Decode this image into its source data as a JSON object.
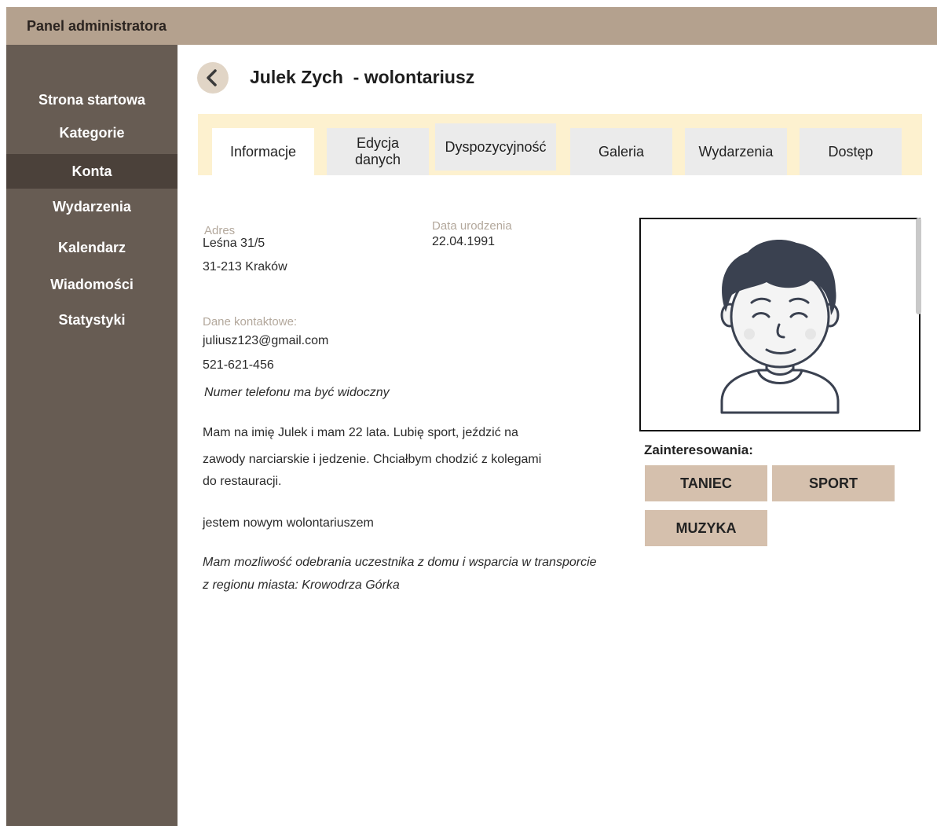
{
  "app": {
    "title": "Panel administratora"
  },
  "sidebar": {
    "items": [
      {
        "label": "Strona startowa"
      },
      {
        "label": "Kategorie"
      },
      {
        "label": "Konta",
        "active": true
      },
      {
        "label": "Wydarzenia"
      },
      {
        "label": "Kalendarz"
      },
      {
        "label": "Wiadomości"
      },
      {
        "label": "Statystyki"
      }
    ]
  },
  "page": {
    "title": "Julek Zych  - wolontariusz"
  },
  "tabs": [
    {
      "label": "Informacje",
      "active": true
    },
    {
      "label": "Edycja\ndanych"
    },
    {
      "label": "Dyspozycyjność"
    },
    {
      "label": "Galeria"
    },
    {
      "label": "Wydarzenia"
    },
    {
      "label": "Dostęp"
    }
  ],
  "profile": {
    "address_label": "Adres",
    "address_line1": "Leśna 31/5",
    "address_line2": "31-213 Kraków",
    "birth_label": "Data urodzenia",
    "birth_date": "22.04.1991",
    "contact_label": "Dane kontaktowe:",
    "email": "juliusz123@gmail.com",
    "phone": "521-621-456",
    "phone_note": "Numer telefonu ma być widoczny",
    "bio_line1": "Mam na imię Julek i mam 22 lata.  Lubię sport, jeździć na",
    "bio_line2": "zawody narciarskie i jedzenie.  Chciałbym chodzić z kolegami",
    "bio_line3": "do restauracji.",
    "status": "jestem nowym wolontariuszem",
    "transport_line1": "Mam mozliwość odebrania uczestnika z domu i wsparcia w transporcie",
    "transport_line2": "z regionu miasta: Krowodrza Górka"
  },
  "interests": {
    "title": "Zainteresowania:",
    "items": [
      "TANIEC",
      "SPORT",
      "MUZYKA"
    ]
  },
  "colors": {
    "topbar": "#b4a18e",
    "sidebar": "#675c53",
    "sidebar_active": "#4b413a",
    "tabs_strip": "#fdf1cf",
    "chip": "#d5c0ad"
  },
  "icons": {
    "back": "chevron-left-icon",
    "avatar": "user-avatar-icon"
  }
}
